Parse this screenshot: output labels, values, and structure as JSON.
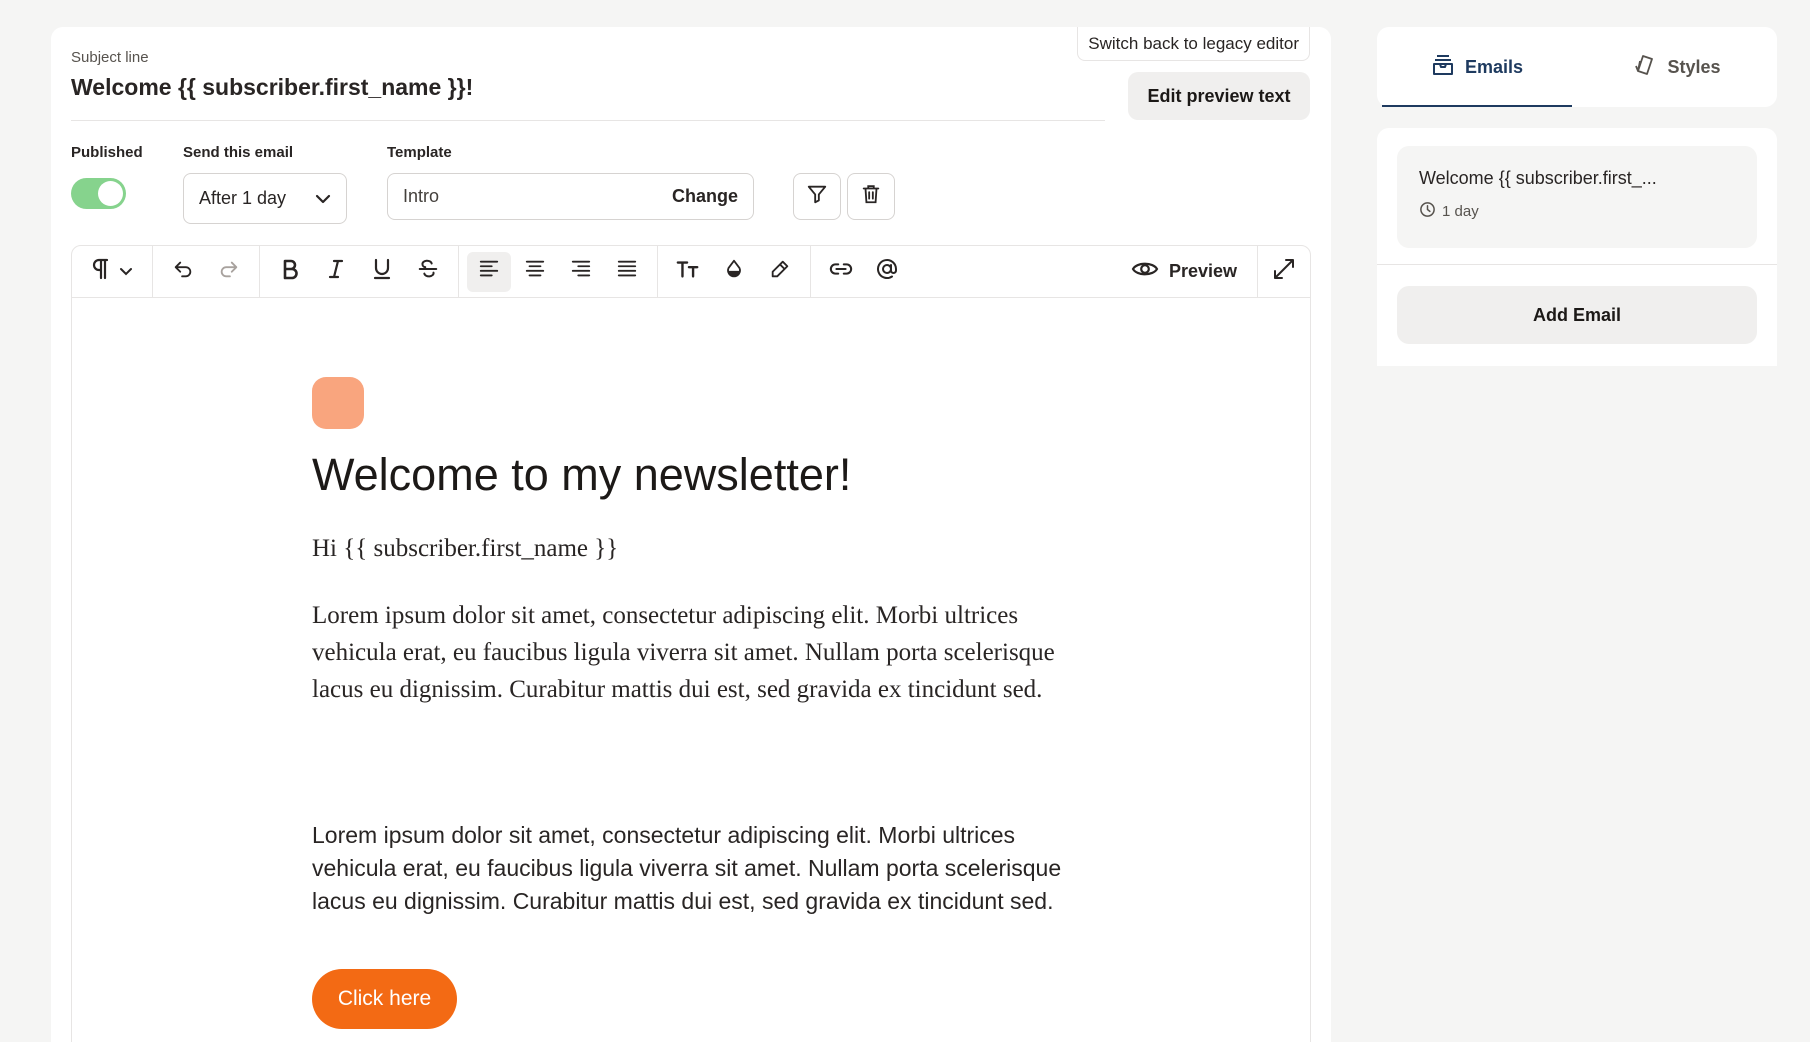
{
  "editor": {
    "legacy_button": "Switch back to legacy editor",
    "subject_label": "Subject line",
    "subject_value": "Welcome {{ subscriber.first_name }}!",
    "preview_text_button": "Edit preview text",
    "published_label": "Published",
    "published": true,
    "send_label": "Send this email",
    "send_value": "After 1 day",
    "template_label": "Template",
    "template_value": "Intro",
    "template_change": "Change",
    "preview_label": "Preview"
  },
  "toolbar_icons": [
    "pilcrow-icon",
    "chevron-down-icon",
    "undo-icon",
    "redo-icon",
    "bold-icon",
    "italic-icon",
    "underline-icon",
    "strikethrough-icon",
    "align-left-icon",
    "align-center-icon",
    "align-right-icon",
    "align-justify-icon",
    "text-size-icon",
    "color-drop-icon",
    "highlight-pen-icon",
    "link-icon",
    "mention-icon",
    "eye-icon",
    "expand-icon"
  ],
  "content": {
    "heading": "Welcome to my newsletter!",
    "greeting": "Hi {{ subscriber.first_name }}",
    "paragraph_serif": "Lorem ipsum dolor sit amet, consectetur adipiscing elit. Morbi ultrices vehicula erat, eu faucibus ligula viverra sit amet. Nullam porta scelerisque lacus eu dignissim. Curabitur mattis dui est, sed gravida ex tincidunt sed.",
    "paragraph_sans": "Lorem ipsum dolor sit amet, consectetur adipiscing elit. Morbi ultrices vehicula erat, eu faucibus ligula viverra sit amet. Nullam porta scelerisque lacus eu dignissim. Curabitur mattis dui est, sed gravida ex tincidunt sed.",
    "cta_label": "Click here"
  },
  "sidebar": {
    "tabs": [
      {
        "label": "Emails",
        "icon": "inbox-stack-icon",
        "active": true
      },
      {
        "label": "Styles",
        "icon": "swatch-icon",
        "active": false
      }
    ],
    "email_card": {
      "title": "Welcome {{ subscriber.first_...",
      "delay": "1 day"
    },
    "add_email": "Add Email"
  },
  "colors": {
    "accent": "#f36a14",
    "logo": "#f9a57e",
    "toggle_on": "#86d38d",
    "tab_active": "#1e3a5f"
  }
}
